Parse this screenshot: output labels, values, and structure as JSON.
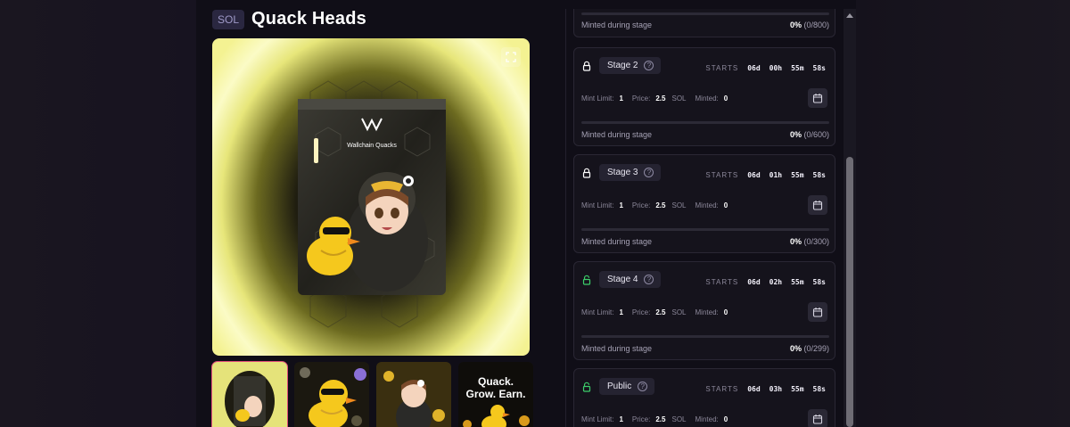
{
  "collection": {
    "chain": "SOL",
    "title": "Quack Heads"
  },
  "media": {
    "pouch_brand": "Wallchain Quacks",
    "thumbnails": [
      {
        "name": "pouch",
        "active": true
      },
      {
        "name": "duck-sunglasses",
        "active": false
      },
      {
        "name": "girl-duck",
        "active": false
      },
      {
        "name": "quack-grow-earn",
        "active": false,
        "text_lines": [
          "Quack.",
          "Grow. Earn."
        ]
      }
    ]
  },
  "stages": {
    "partial_top": {
      "minted_label": "Minted during stage",
      "percent": "0%",
      "count": "(0/800)",
      "fill_fraction": 0
    },
    "items": [
      {
        "name": "Stage 2",
        "lock": "locked",
        "starts_label": "STARTS",
        "countdown": [
          "06d",
          "00h",
          "55m",
          "58s"
        ],
        "mint_limit_label": "Mint Limit:",
        "mint_limit": "1",
        "price_label": "Price:",
        "price": "2.5",
        "currency": "SOL",
        "minted_label_short": "Minted:",
        "minted": "0",
        "minted_label": "Minted during stage",
        "percent": "0%",
        "count": "(0/600)",
        "fill_fraction": 0
      },
      {
        "name": "Stage 3",
        "lock": "locked",
        "starts_label": "STARTS",
        "countdown": [
          "06d",
          "01h",
          "55m",
          "58s"
        ],
        "mint_limit_label": "Mint Limit:",
        "mint_limit": "1",
        "price_label": "Price:",
        "price": "2.5",
        "currency": "SOL",
        "minted_label_short": "Minted:",
        "minted": "0",
        "minted_label": "Minted during stage",
        "percent": "0%",
        "count": "(0/300)",
        "fill_fraction": 0
      },
      {
        "name": "Stage 4",
        "lock": "unlocked",
        "starts_label": "STARTS",
        "countdown": [
          "06d",
          "02h",
          "55m",
          "58s"
        ],
        "mint_limit_label": "Mint Limit:",
        "mint_limit": "1",
        "price_label": "Price:",
        "price": "2.5",
        "currency": "SOL",
        "minted_label_short": "Minted:",
        "minted": "0",
        "minted_label": "Minted during stage",
        "percent": "0%",
        "count": "(0/299)",
        "fill_fraction": 0
      },
      {
        "name": "Public",
        "lock": "unlocked",
        "starts_label": "STARTS",
        "countdown": [
          "06d",
          "03h",
          "55m",
          "58s"
        ],
        "mint_limit_label": "Mint Limit:",
        "mint_limit": "1",
        "price_label": "Price:",
        "price": "2.5",
        "currency": "SOL",
        "minted_label_short": "Minted:",
        "minted": "0"
      }
    ]
  },
  "colors": {
    "accent": "#7e5cf0",
    "active_thumb_border": "#e24d7a",
    "unlocked_icon": "#3ccf6a",
    "locked_icon": "#ffffff"
  }
}
